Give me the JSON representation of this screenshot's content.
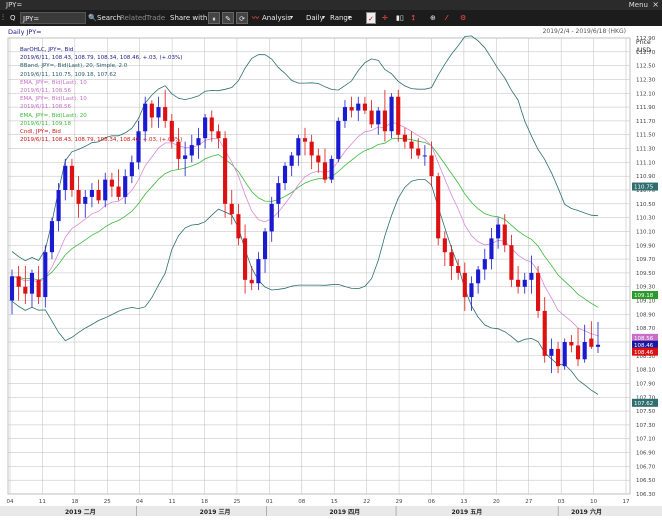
{
  "window": {
    "title": "JPY=",
    "menu": "Menu",
    "close": "×"
  },
  "toolbar": {
    "ric": "JPY=",
    "search": "Search",
    "related": "Related",
    "trade": "Trade",
    "share": "Share with...",
    "analysis": "Analysis",
    "interval": "Daily",
    "range": "Range"
  },
  "chart": {
    "header": "Daily JPY=",
    "date_range": "2019/2/4 - 2019/6/18 (HKG)",
    "axis_unit": "Price\n/USD"
  },
  "legend": [
    {
      "text": "BarOHLC, JPY=, Bid",
      "color": "#1a1a8a"
    },
    {
      "text": "2019/6/11, 108.43, 108.79, 108.34, 108.46, +.03, (+.03%)",
      "color": "#1a1a8a"
    },
    {
      "text": "BBand, JPY=, Bid(Last), 20, Simple, 2.0",
      "color": "#2a5e6e"
    },
    {
      "text": "2019/6/11, 110.75, 109.18, 107.62",
      "color": "#2a5e6e"
    },
    {
      "text": "EMA, JPY=, Bid(Last), 10",
      "color": "#c86ec8"
    },
    {
      "text": "2019/6/11, 108.56",
      "color": "#c86ec8"
    },
    {
      "text": "EMA, JPY=, Bid(Last), 10",
      "color": "#c86ec8"
    },
    {
      "text": "2019/6/11, 108.56",
      "color": "#c86ec8"
    },
    {
      "text": "EMA, JPY=, Bid(Last), 20",
      "color": "#3cb83c"
    },
    {
      "text": "2019/6/11, 109.18",
      "color": "#3cb83c"
    },
    {
      "text": "Cndl, JPY=, Bid",
      "color": "#cc1111"
    },
    {
      "text": "2019/6/11, 108.43, 108.79, 108.34, 108.46, +.03, (+.03%)",
      "color": "#cc1111"
    }
  ],
  "chart_data": {
    "type": "candlestick",
    "title": "Daily JPY=",
    "ylim": [
      106.3,
      112.9
    ],
    "y_ticks": [
      106.3,
      106.5,
      106.7,
      106.9,
      107.1,
      107.3,
      107.5,
      107.7,
      107.9,
      108.1,
      108.3,
      108.5,
      108.7,
      108.9,
      109.1,
      109.3,
      109.5,
      109.7,
      109.9,
      110.1,
      110.3,
      110.5,
      110.7,
      110.9,
      111.1,
      111.3,
      111.5,
      111.7,
      111.9,
      112.1,
      112.3,
      112.5,
      112.7,
      112.9
    ],
    "x_day_labels": [
      "04",
      "11",
      "18",
      "25",
      "04",
      "11",
      "18",
      "25",
      "01",
      "08",
      "15",
      "22",
      "29",
      "06",
      "13",
      "20",
      "27",
      "03",
      "10",
      "17"
    ],
    "x_month_labels": [
      "2019 二月",
      "2019 三月",
      "2019 四月",
      "2019 五月",
      "2019 六月"
    ],
    "price_tags": [
      {
        "text": "110.75",
        "value": 110.75,
        "bg": "#2e6e6e",
        "fg": "#ffffff"
      },
      {
        "text": "109.18",
        "value": 109.18,
        "bg": "#2a9a2a",
        "fg": "#ffffff"
      },
      {
        "text": "108.56",
        "value": 108.56,
        "bg": "#c86ec8",
        "fg": "#ffffff"
      },
      {
        "text": "108.46",
        "value": 108.46,
        "bg": "#1a1aa0",
        "fg": "#ffffff"
      },
      {
        "text": "108.46",
        "value": 108.36,
        "bg": "#dd1111",
        "fg": "#ffffff"
      },
      {
        "text": "107.62",
        "value": 107.62,
        "bg": "#2e6e6e",
        "fg": "#ffffff"
      }
    ],
    "bars": [
      {
        "o": 109.1,
        "h": 109.55,
        "l": 108.9,
        "c": 109.45
      },
      {
        "o": 109.45,
        "h": 109.6,
        "l": 109.1,
        "c": 109.3
      },
      {
        "o": 109.3,
        "h": 109.6,
        "l": 109.05,
        "c": 109.2
      },
      {
        "o": 109.2,
        "h": 109.55,
        "l": 109.0,
        "c": 109.5
      },
      {
        "o": 109.4,
        "h": 109.6,
        "l": 109.05,
        "c": 109.15
      },
      {
        "o": 109.15,
        "h": 109.9,
        "l": 109.0,
        "c": 109.8
      },
      {
        "o": 109.8,
        "h": 110.3,
        "l": 109.7,
        "c": 110.25
      },
      {
        "o": 110.25,
        "h": 110.8,
        "l": 110.1,
        "c": 110.7
      },
      {
        "o": 110.7,
        "h": 111.15,
        "l": 110.55,
        "c": 111.05
      },
      {
        "o": 111.05,
        "h": 111.15,
        "l": 110.6,
        "c": 110.7
      },
      {
        "o": 110.7,
        "h": 110.9,
        "l": 110.3,
        "c": 110.5
      },
      {
        "o": 110.5,
        "h": 110.7,
        "l": 110.3,
        "c": 110.6
      },
      {
        "o": 110.6,
        "h": 110.8,
        "l": 110.45,
        "c": 110.7
      },
      {
        "o": 110.7,
        "h": 110.85,
        "l": 110.5,
        "c": 110.55
      },
      {
        "o": 110.55,
        "h": 110.95,
        "l": 110.45,
        "c": 110.85
      },
      {
        "o": 110.85,
        "h": 110.95,
        "l": 110.6,
        "c": 110.75
      },
      {
        "o": 110.75,
        "h": 111.0,
        "l": 110.55,
        "c": 110.6
      },
      {
        "o": 110.6,
        "h": 111.0,
        "l": 110.5,
        "c": 110.9
      },
      {
        "o": 110.9,
        "h": 111.2,
        "l": 110.8,
        "c": 111.1
      },
      {
        "o": 111.1,
        "h": 111.7,
        "l": 111.0,
        "c": 111.55
      },
      {
        "o": 111.55,
        "h": 112.05,
        "l": 111.4,
        "c": 111.95
      },
      {
        "o": 111.95,
        "h": 112.0,
        "l": 111.6,
        "c": 111.75
      },
      {
        "o": 111.75,
        "h": 112.05,
        "l": 111.6,
        "c": 111.9
      },
      {
        "o": 111.9,
        "h": 112.15,
        "l": 111.6,
        "c": 111.7
      },
      {
        "o": 111.7,
        "h": 111.8,
        "l": 111.3,
        "c": 111.4
      },
      {
        "o": 111.4,
        "h": 111.6,
        "l": 111.0,
        "c": 111.15
      },
      {
        "o": 111.15,
        "h": 111.4,
        "l": 110.9,
        "c": 111.2
      },
      {
        "o": 111.2,
        "h": 111.5,
        "l": 111.1,
        "c": 111.35
      },
      {
        "o": 111.35,
        "h": 111.6,
        "l": 111.15,
        "c": 111.45
      },
      {
        "o": 111.45,
        "h": 111.8,
        "l": 111.3,
        "c": 111.75
      },
      {
        "o": 111.75,
        "h": 111.85,
        "l": 111.4,
        "c": 111.55
      },
      {
        "o": 111.55,
        "h": 111.65,
        "l": 111.3,
        "c": 111.45
      },
      {
        "o": 111.45,
        "h": 111.55,
        "l": 110.3,
        "c": 110.5
      },
      {
        "o": 110.5,
        "h": 110.7,
        "l": 110.2,
        "c": 110.35
      },
      {
        "o": 110.35,
        "h": 110.5,
        "l": 109.9,
        "c": 110.0
      },
      {
        "o": 110.0,
        "h": 110.2,
        "l": 109.2,
        "c": 109.4
      },
      {
        "o": 109.4,
        "h": 109.6,
        "l": 109.25,
        "c": 109.35
      },
      {
        "o": 109.35,
        "h": 109.8,
        "l": 109.25,
        "c": 109.7
      },
      {
        "o": 109.7,
        "h": 110.15,
        "l": 109.5,
        "c": 110.1
      },
      {
        "o": 110.1,
        "h": 110.6,
        "l": 109.95,
        "c": 110.5
      },
      {
        "o": 110.5,
        "h": 110.9,
        "l": 110.3,
        "c": 110.8
      },
      {
        "o": 110.8,
        "h": 111.1,
        "l": 110.7,
        "c": 111.05
      },
      {
        "o": 111.05,
        "h": 111.25,
        "l": 110.9,
        "c": 111.2
      },
      {
        "o": 111.2,
        "h": 111.5,
        "l": 111.05,
        "c": 111.45
      },
      {
        "o": 111.45,
        "h": 111.6,
        "l": 111.2,
        "c": 111.4
      },
      {
        "o": 111.4,
        "h": 111.5,
        "l": 111.0,
        "c": 111.2
      },
      {
        "o": 111.2,
        "h": 111.3,
        "l": 110.95,
        "c": 111.1
      },
      {
        "o": 111.1,
        "h": 111.3,
        "l": 110.8,
        "c": 110.85
      },
      {
        "o": 110.85,
        "h": 111.2,
        "l": 110.8,
        "c": 111.15
      },
      {
        "o": 111.15,
        "h": 111.75,
        "l": 111.1,
        "c": 111.7
      },
      {
        "o": 111.7,
        "h": 112.0,
        "l": 111.6,
        "c": 111.9
      },
      {
        "o": 111.9,
        "h": 112.05,
        "l": 111.75,
        "c": 111.85
      },
      {
        "o": 111.85,
        "h": 112.05,
        "l": 111.7,
        "c": 111.95
      },
      {
        "o": 111.95,
        "h": 112.05,
        "l": 111.8,
        "c": 111.85
      },
      {
        "o": 111.85,
        "h": 112.0,
        "l": 111.6,
        "c": 111.65
      },
      {
        "o": 111.65,
        "h": 111.9,
        "l": 111.5,
        "c": 111.85
      },
      {
        "o": 111.85,
        "h": 112.15,
        "l": 111.4,
        "c": 111.55
      },
      {
        "o": 111.55,
        "h": 112.1,
        "l": 111.45,
        "c": 112.05
      },
      {
        "o": 112.05,
        "h": 112.15,
        "l": 111.4,
        "c": 111.5
      },
      {
        "o": 111.5,
        "h": 111.6,
        "l": 111.3,
        "c": 111.4
      },
      {
        "o": 111.4,
        "h": 111.55,
        "l": 111.15,
        "c": 111.3
      },
      {
        "o": 111.3,
        "h": 111.45,
        "l": 111.15,
        "c": 111.2
      },
      {
        "o": 111.2,
        "h": 111.35,
        "l": 111.05,
        "c": 111.2
      },
      {
        "o": 111.2,
        "h": 111.4,
        "l": 110.75,
        "c": 110.9
      },
      {
        "o": 110.9,
        "h": 110.95,
        "l": 109.9,
        "c": 110.0
      },
      {
        "o": 110.0,
        "h": 110.1,
        "l": 109.6,
        "c": 109.8
      },
      {
        "o": 109.8,
        "h": 109.9,
        "l": 109.4,
        "c": 109.6
      },
      {
        "o": 109.6,
        "h": 109.7,
        "l": 109.4,
        "c": 109.5
      },
      {
        "o": 109.5,
        "h": 109.65,
        "l": 108.95,
        "c": 109.15
      },
      {
        "o": 109.15,
        "h": 109.45,
        "l": 108.95,
        "c": 109.35
      },
      {
        "o": 109.35,
        "h": 109.6,
        "l": 109.2,
        "c": 109.55
      },
      {
        "o": 109.55,
        "h": 109.85,
        "l": 109.4,
        "c": 109.7
      },
      {
        "o": 109.7,
        "h": 110.15,
        "l": 109.55,
        "c": 110.0
      },
      {
        "o": 110.0,
        "h": 110.3,
        "l": 109.85,
        "c": 110.2
      },
      {
        "o": 110.2,
        "h": 110.35,
        "l": 109.8,
        "c": 109.9
      },
      {
        "o": 109.9,
        "h": 110.05,
        "l": 109.3,
        "c": 109.4
      },
      {
        "o": 109.4,
        "h": 109.6,
        "l": 109.2,
        "c": 109.3
      },
      {
        "o": 109.3,
        "h": 109.5,
        "l": 109.2,
        "c": 109.4
      },
      {
        "o": 109.4,
        "h": 109.75,
        "l": 109.2,
        "c": 109.5
      },
      {
        "o": 109.5,
        "h": 109.6,
        "l": 108.85,
        "c": 108.95
      },
      {
        "o": 108.95,
        "h": 109.15,
        "l": 108.2,
        "c": 108.3
      },
      {
        "o": 108.3,
        "h": 108.55,
        "l": 108.05,
        "c": 108.4
      },
      {
        "o": 108.4,
        "h": 108.5,
        "l": 108.05,
        "c": 108.15
      },
      {
        "o": 108.15,
        "h": 108.55,
        "l": 108.1,
        "c": 108.5
      },
      {
        "o": 108.5,
        "h": 108.6,
        "l": 108.35,
        "c": 108.45
      },
      {
        "o": 108.45,
        "h": 108.7,
        "l": 108.15,
        "c": 108.25
      },
      {
        "o": 108.25,
        "h": 108.75,
        "l": 108.2,
        "c": 108.5
      },
      {
        "o": 108.55,
        "h": 108.8,
        "l": 108.4,
        "c": 108.43
      },
      {
        "o": 108.43,
        "h": 108.79,
        "l": 108.34,
        "c": 108.46
      }
    ]
  }
}
